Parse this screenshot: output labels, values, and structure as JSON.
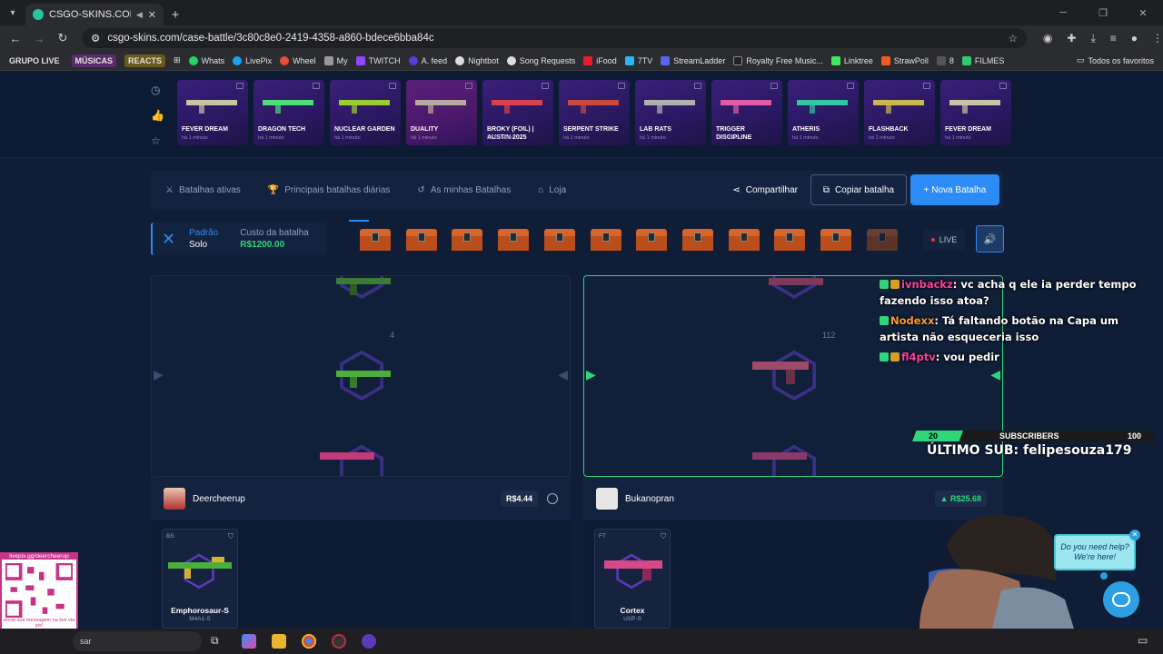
{
  "browser": {
    "tab_title": "CSGO-SKINS.COM — As m",
    "url": "csgo-skins.com/case-battle/3c80c8e0-2419-4358-a860-bdece6bba84c",
    "bookmarks": [
      {
        "label": "GRUPO LIVE",
        "color": "#2b2c30"
      },
      {
        "label": "MÚSICAS",
        "color": "#5b2a6a"
      },
      {
        "label": "REACTS",
        "color": "#6a5a1a"
      },
      {
        "label": "Whats",
        "color": "#25d366"
      },
      {
        "label": "LivePix",
        "color": "#1da1f2"
      },
      {
        "label": "Wheel",
        "color": "#e74c3c"
      },
      {
        "label": "My",
        "color": "#999999"
      },
      {
        "label": "TWITCH",
        "color": "#9146ff"
      },
      {
        "label": "A. feed",
        "color": "#5c3bd6"
      },
      {
        "label": "Nightbot",
        "color": "#dddddd"
      },
      {
        "label": "Song Requests",
        "color": "#dddddd"
      },
      {
        "label": "iFood",
        "color": "#ea1d2c"
      },
      {
        "label": "7TV",
        "color": "#29b6f6"
      },
      {
        "label": "StreamLadder",
        "color": "#5865f2"
      },
      {
        "label": "Royalty Free Music...",
        "color": "#222222"
      },
      {
        "label": "Linktree",
        "color": "#43e660"
      },
      {
        "label": "StrawPoll",
        "color": "#f15a24"
      },
      {
        "label": "8",
        "color": "#555555"
      },
      {
        "label": "FILMES",
        "color": "#2ecc71"
      }
    ],
    "all_favorites": "Todos os favoritos"
  },
  "drops": [
    {
      "name": "FEVER DREAM",
      "time": "há 1 minuto",
      "color": "#c9c3a6"
    },
    {
      "name": "DRAGON TECH",
      "time": "há 1 minuto",
      "color": "#4fdc7a"
    },
    {
      "name": "NUCLEAR GARDEN",
      "time": "há 1 minuto",
      "color": "#9acd32"
    },
    {
      "name": "DUALITY",
      "time": "há 1 minuto",
      "color": "#b8a9a0"
    },
    {
      "name": "BROKY (FOIL) | AUSTIN 2025",
      "time": "há 1 minuto",
      "color": "#d94050"
    },
    {
      "name": "SERPENT STRIKE",
      "time": "há 1 minuto",
      "color": "#c84a3a"
    },
    {
      "name": "LAB RATS",
      "time": "há 1 minuto",
      "color": "#b0b0b0"
    },
    {
      "name": "TRIGGER DISCIPLINE",
      "time": "há 1 minuto",
      "color": "#e25ba8"
    },
    {
      "name": "ATHERIS",
      "time": "há 1 minuto",
      "color": "#34c6a4"
    },
    {
      "name": "FLASHBACK",
      "time": "há 1 minuto",
      "color": "#c8b850"
    },
    {
      "name": "FEVER DREAM",
      "time": "há 1 minuto",
      "color": "#c9c3a6"
    }
  ],
  "battle_nav": {
    "active": "Batalhas ativas",
    "daily": "Principais batalhas diárias",
    "mine": "As minhas Batalhas",
    "shop": "Loja",
    "share": "Compartilhar",
    "copy": "Copiar batalha",
    "new": "+ Nova Batalha"
  },
  "mode": {
    "label": "Padrão",
    "value": "Solo",
    "cost_label": "Custo da batalha",
    "cost_value": "R$1200.00"
  },
  "live_label": "LIVE",
  "reels": {
    "left_count": "4",
    "right_count": "112"
  },
  "players": [
    {
      "name": "Deercheerup",
      "total": "R$4.44",
      "item": {
        "cond": "BS",
        "name": "Emphorosaur-S",
        "sub": "M4A1-S",
        "color": "#4caf3a"
      }
    },
    {
      "name": "Bukanopran",
      "total": "▲ R$25.68",
      "item": {
        "cond": "FT",
        "name": "Cortex",
        "sub": "USP-S",
        "color": "#d64a8a"
      }
    }
  ],
  "chat": [
    {
      "user": "ivnbackz",
      "color": "#ff3fa0",
      "msg": ": vc acha q ele ia perder tempo fazendo isso atoa?"
    },
    {
      "user": "Nodexx",
      "color": "#ff9a2e",
      "msg": ": Tá faltando botão na Capa um artista não esqueceria isso"
    },
    {
      "user": "fl4ptv",
      "color": "#ff3fa0",
      "msg": ": vou pedir"
    }
  ],
  "subs": {
    "current": "20",
    "label": "SUBSCRIBERS",
    "goal": "100",
    "progress": 0.2,
    "last": "ÚLTIMO SUB: felipesouza179"
  },
  "help": {
    "line1": "Do you need help?",
    "line2": "We're here!"
  },
  "qr": {
    "top": "livepix.gg/deercheerup",
    "bottom": "envie sua mensagem na live via pix!"
  },
  "taskbar": {
    "search": "sar"
  }
}
